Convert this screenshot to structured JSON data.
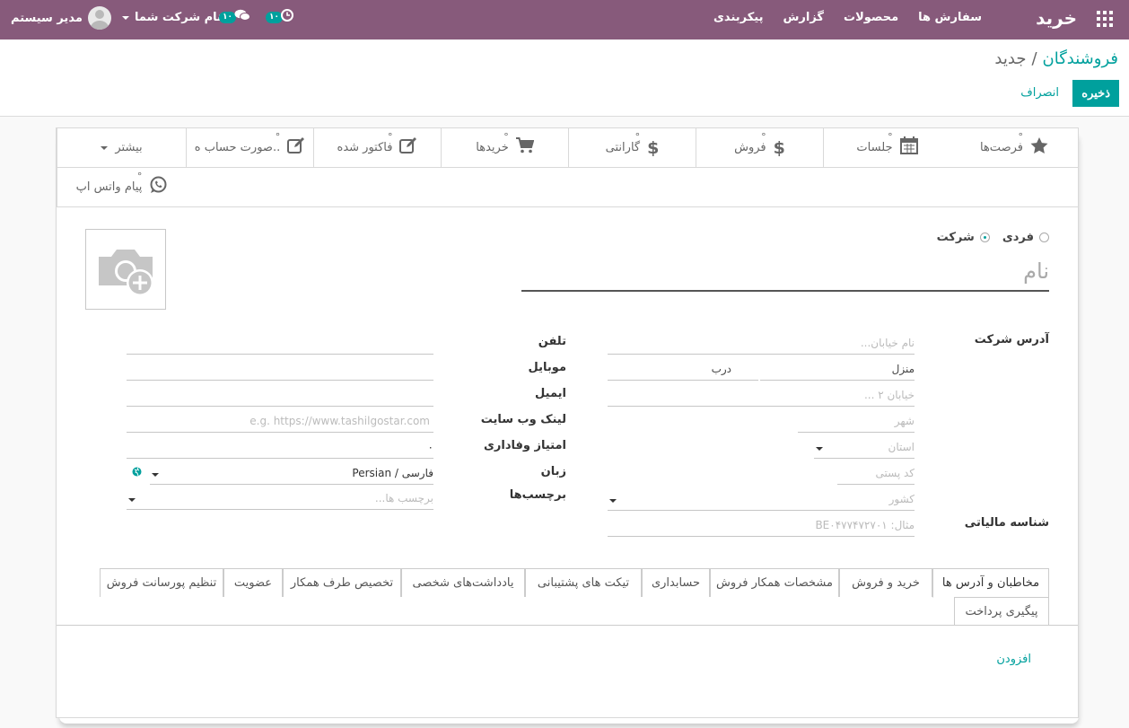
{
  "navbar": {
    "app_title": "خرید",
    "menu": [
      "سفارش ها",
      "محصولات",
      "گزارش",
      "پیکربندی"
    ],
    "user_name": "مدیر سیستم",
    "company_name": "نام شرکت شما",
    "chat_count": "۱۰",
    "activity_count": "۱۰"
  },
  "breadcrumb": {
    "parent": "فروشندگان",
    "separator": "/",
    "current": "جدید"
  },
  "actions": {
    "save": "ذخیره",
    "discard": "انصراف"
  },
  "smart_buttons": {
    "opportunities": "فرصت‌ها",
    "meetings": "جلسات",
    "sales": "فروش",
    "warranty": "گارانتی",
    "purchases": "خریدها",
    "invoiced": "فاکتور شده",
    "statements": "صورت حساب ه..",
    "more": "بیشتر",
    "whatsapp": "پیام واتس اپ"
  },
  "company_type": {
    "individual": "فردی",
    "company": "شرکت",
    "selected": "company"
  },
  "name_placeholder": "نام",
  "address": {
    "label": "آدرس شرکت",
    "street": "نام خیابان...",
    "house": "منزل",
    "door": "درب",
    "street2": "خیابان ۲ ...",
    "city": "شهر",
    "state": "استان",
    "zip": "کد پستی",
    "country": "کشور"
  },
  "tax": {
    "label": "شناسه مالیاتی",
    "placeholder": "مثال: BE۰۴۷۷۴۷۲۷۰۱"
  },
  "contact": {
    "phone_label": "تلفن",
    "mobile_label": "موبایل",
    "email_label": "ایمیل",
    "website_label": "لینک وب سایت",
    "website_placeholder": "e.g. https://www.tashilgostar.com",
    "loyalty_label": "امتیاز وفاداری",
    "loyalty_value": "۰",
    "language_label": "زبان",
    "language_value": "Persian / فارسی",
    "tags_label": "برچسب‌ها",
    "tags_placeholder": "برچسب ها..."
  },
  "tabs": [
    "مخاطبان و آدرس ها",
    "خرید و فروش",
    "مشخصات همکار فروش",
    "حسابداری",
    "تیکت های پشتیبانی",
    "یادداشت‌های شخصی",
    "تخصیص طرف همکار",
    "عضویت",
    "تنظیم پورسانت فروش",
    "پیگیری پرداخت"
  ],
  "add_link": "افزودن",
  "colors": {
    "navbar": "#875a7b",
    "accent": "#00a09d"
  }
}
